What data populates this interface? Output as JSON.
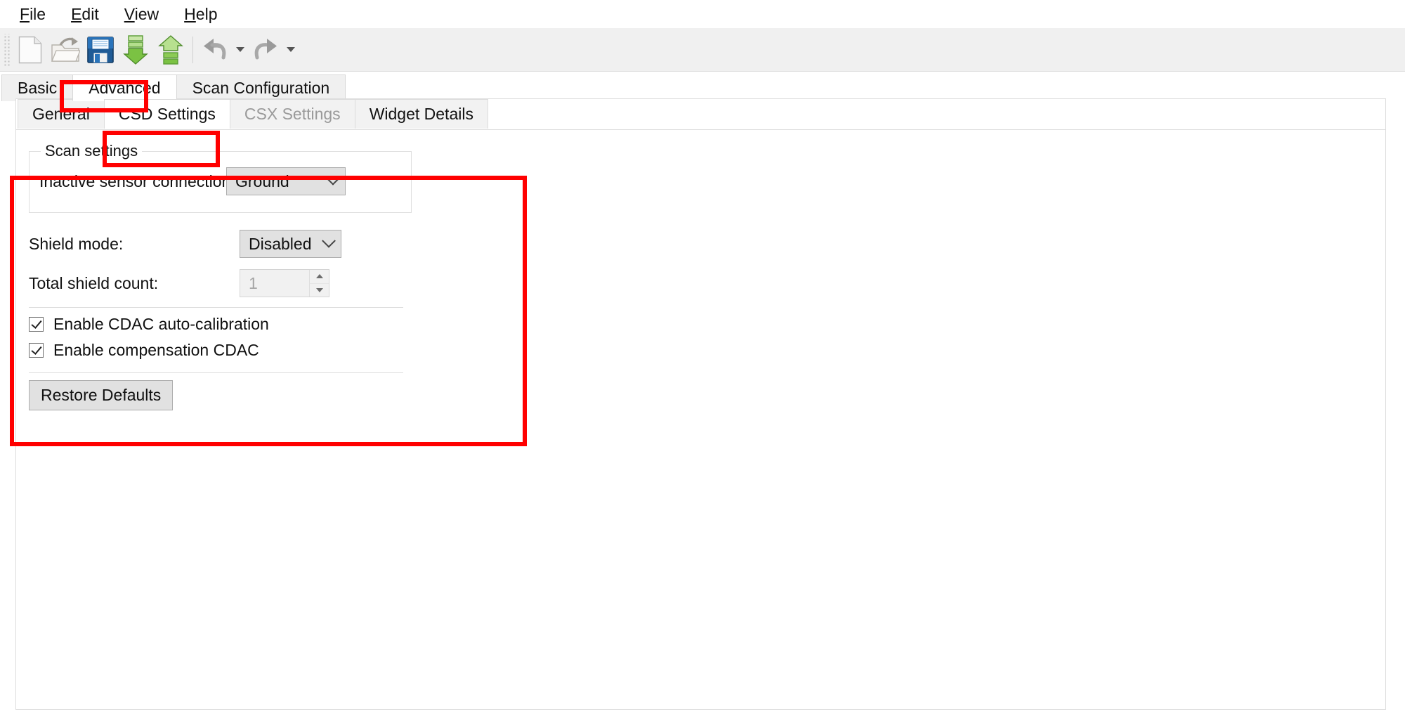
{
  "menu": {
    "items": [
      {
        "label": "File",
        "mnemonic": "F",
        "rest": "ile"
      },
      {
        "label": "Edit",
        "mnemonic": "E",
        "rest": "dit"
      },
      {
        "label": "View",
        "mnemonic": "V",
        "rest": "iew"
      },
      {
        "label": "Help",
        "mnemonic": "H",
        "rest": "elp"
      }
    ]
  },
  "toolbar": {
    "buttons": [
      {
        "name": "new-file-icon",
        "title": "New"
      },
      {
        "name": "open-folder-icon",
        "title": "Open"
      },
      {
        "name": "save-floppy-icon",
        "title": "Save"
      },
      {
        "name": "import-download-icon",
        "title": "Import"
      },
      {
        "name": "export-upload-icon",
        "title": "Export"
      },
      {
        "name": "undo-icon",
        "title": "Undo"
      },
      {
        "name": "redo-icon",
        "title": "Redo"
      }
    ]
  },
  "outer_tabs": {
    "items": [
      {
        "label": "Basic",
        "active": false,
        "disabled": false
      },
      {
        "label": "Advanced",
        "active": true,
        "disabled": false
      },
      {
        "label": "Scan Configuration",
        "active": false,
        "disabled": false
      }
    ]
  },
  "inner_tabs": {
    "items": [
      {
        "label": "General",
        "active": false,
        "disabled": false
      },
      {
        "label": "CSD Settings",
        "active": true,
        "disabled": false
      },
      {
        "label": "CSX Settings",
        "active": false,
        "disabled": true
      },
      {
        "label": "Widget Details",
        "active": false,
        "disabled": false
      }
    ]
  },
  "form": {
    "scan_settings_group": {
      "title": "Scan settings",
      "inactive_sensor_label": "Inactive sensor connection:",
      "inactive_sensor_value": "Ground"
    },
    "shield_mode_label": "Shield mode:",
    "shield_mode_value": "Disabled",
    "total_shield_count_label": "Total shield count:",
    "total_shield_count_value": "1",
    "checkbox_cdac_autocal": "Enable CDAC auto-calibration",
    "checkbox_compensation_cdac": "Enable compensation CDAC",
    "restore_defaults_label": "Restore Defaults"
  },
  "colors": {
    "annotation": "#ff0000",
    "toolbar_bg": "#f0f0f0",
    "tab_inactive_bg": "#f0f0f0",
    "control_bg": "#e1e1e1",
    "disabled_text": "#9a9a9a"
  }
}
